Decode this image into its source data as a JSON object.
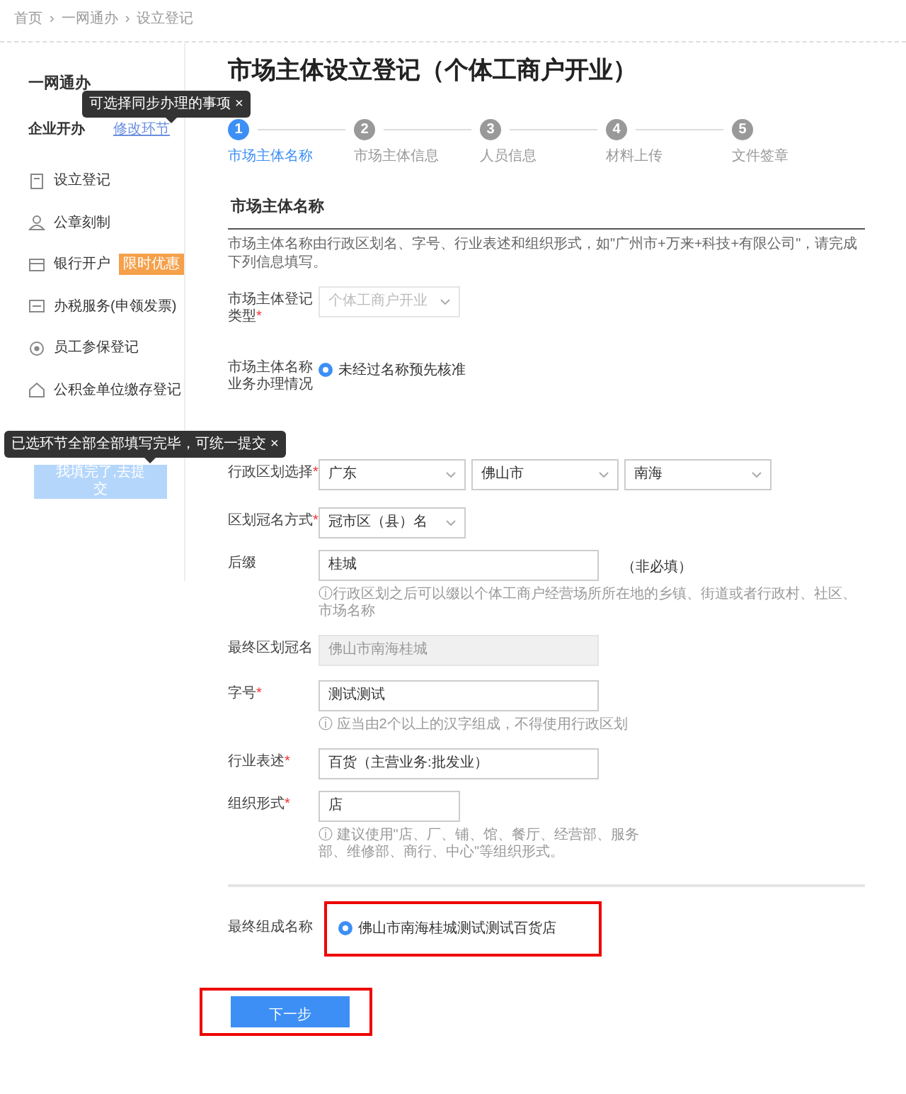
{
  "breadcrumb": {
    "separator": "›",
    "items": [
      {
        "label": "首页"
      },
      {
        "label": "一网通办"
      },
      {
        "label": "设立登记"
      }
    ]
  },
  "sidebar": {
    "title": "一网通办",
    "section": "企业开办",
    "edit_link": "修改环节",
    "tooltip": "可选择同步办理的事项",
    "tooltip_close": "×",
    "items": [
      {
        "label": "设立登记"
      },
      {
        "label": "公章刻制"
      },
      {
        "label": "银行开户",
        "badge": "限时优惠"
      },
      {
        "label": "办税服务(申领发票)"
      },
      {
        "label": "员工参保登记"
      },
      {
        "label": "公积金单位缴存登记"
      }
    ],
    "submit_tooltip": "已选环节全部全部填写完毕，可统一提交",
    "submit_tooltip_close": "×",
    "submit_button": "我填完了,去提交"
  },
  "title": "市场主体设立登记（个体工商户开业）",
  "steps": [
    {
      "number": "1",
      "label": "市场主体名称",
      "selected": true
    },
    {
      "number": "2",
      "label": "市场主体信息",
      "selected": false
    },
    {
      "number": "3",
      "label": "人员信息",
      "selected": false
    },
    {
      "number": "4",
      "label": "材料上传",
      "selected": false
    },
    {
      "number": "5",
      "label": "文件签章",
      "selected": false
    }
  ],
  "section_title": "市场主体名称",
  "description": "市场主体名称由行政区划名、字号、行业表述和组织形式，如\"广州市+万来+科技+有限公司\"，请完成下列信息填写。",
  "fields": [
    {
      "kind": "select",
      "label": "市场主体登记类型",
      "required": true,
      "disabled": true,
      "values": [
        "个体工商户开业"
      ]
    },
    {
      "kind": "radio",
      "label": "市场主体名称业务办理情况",
      "required": false,
      "options": [
        {
          "label": "未经过名称预先核准",
          "selected": true
        }
      ]
    },
    {
      "kind": "select",
      "label": "行政区划选择",
      "required": true,
      "disabled": false,
      "values": [
        "广东",
        "佛山市",
        "南海"
      ]
    },
    {
      "kind": "select",
      "label": "区划冠名方式",
      "required": true,
      "disabled": false,
      "values": [
        "冠市区（县）名"
      ]
    },
    {
      "kind": "text",
      "label": "后缀",
      "required": false,
      "value": "桂城",
      "note": "（非必填）",
      "hint": "ⓘ行政区划之后可以缀以个体工商户经营场所所在地的乡镇、街道或者行政村、社区、市场名称"
    },
    {
      "kind": "readonly",
      "label": "最终区划冠名",
      "required": false,
      "value": "佛山市南海桂城"
    },
    {
      "kind": "text",
      "label": "字号",
      "required": true,
      "value": "测试测试",
      "hint": "ⓘ 应当由2个以上的汉字组成，不得使用行政区划"
    },
    {
      "kind": "text",
      "label": "行业表述",
      "required": true,
      "value": "百货（主营业务:批发业）"
    },
    {
      "kind": "text",
      "label": "组织形式",
      "required": true,
      "value": "店",
      "hint": "ⓘ 建议使用\"店、厂、铺、馆、餐厅、经营部、服务部、维修部、商行、中心\"等组织形式。"
    }
  ],
  "final_name": {
    "label": "最终组成名称",
    "options": [
      {
        "label": "佛山市南海桂城测试测试百货店",
        "selected": true
      }
    ],
    "highlighted": true
  },
  "next_button": {
    "label": "下一步",
    "highlighted": true
  },
  "required_mark": "*"
}
